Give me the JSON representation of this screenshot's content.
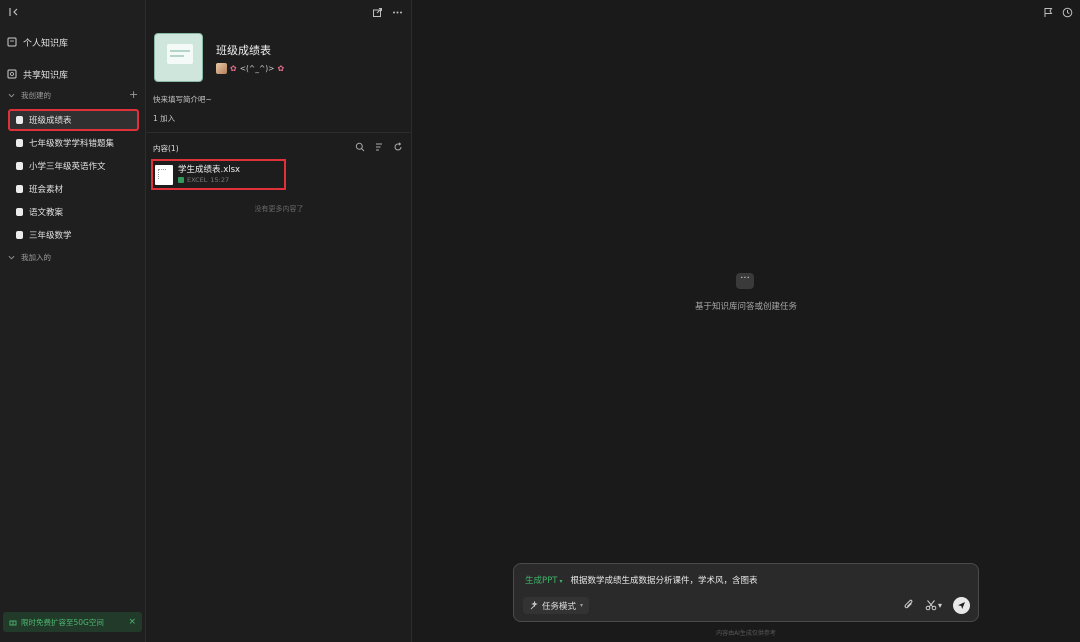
{
  "sidebar": {
    "personal_kb": "个人知识库",
    "shared_kb": "共享知识库",
    "group_created": "我创建的",
    "group_joined": "我加入的",
    "items": [
      {
        "label": "班级成绩表"
      },
      {
        "label": "七年级数学学科错题集"
      },
      {
        "label": "小学三年级英语作文"
      },
      {
        "label": "班会素材"
      },
      {
        "label": "语文教案"
      },
      {
        "label": "三年级数学"
      }
    ],
    "promo_text": "限时免费扩容至50G空间",
    "promo_close": "×"
  },
  "knowledge_base": {
    "title": "班级成绩表",
    "owner_name": "<(^_^)>",
    "description": "快来填写简介吧~",
    "joined_count": "1 加入",
    "content_label": "内容(1)",
    "files": [
      {
        "name": "学生成绩表.xlsx",
        "type": "EXCEL",
        "time": "15:27"
      }
    ],
    "no_more": "没有更多内容了"
  },
  "chat": {
    "empty_hint": "基于知识库问答或创建任务",
    "ppt_tag": "生成PPT",
    "prompt_text": "根据数学成绩生成数据分析课件，学术风，含图表",
    "mode_label": "任务模式",
    "footnote": "内容由AI生成仅供参考"
  }
}
